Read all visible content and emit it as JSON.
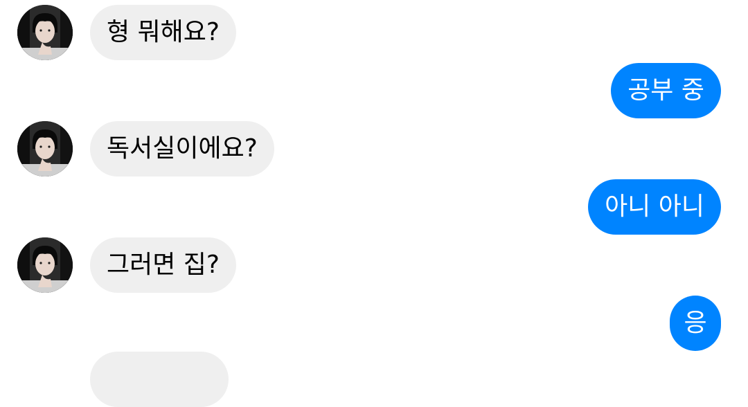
{
  "conversation": {
    "contact_avatar_icon": "avatar-photo",
    "colors": {
      "incoming_bubble": "#efefef",
      "outgoing_bubble": "#0084ff",
      "incoming_text": "#000000",
      "outgoing_text": "#ffffff"
    },
    "messages": [
      {
        "side": "incoming",
        "text": "형 뭐해요?"
      },
      {
        "side": "outgoing",
        "text": "공부 중"
      },
      {
        "side": "incoming",
        "text": "독서실이에요?"
      },
      {
        "side": "outgoing",
        "text": "아니 아니"
      },
      {
        "side": "incoming",
        "text": "그러면 집?"
      },
      {
        "side": "outgoing",
        "text": "응"
      }
    ]
  }
}
